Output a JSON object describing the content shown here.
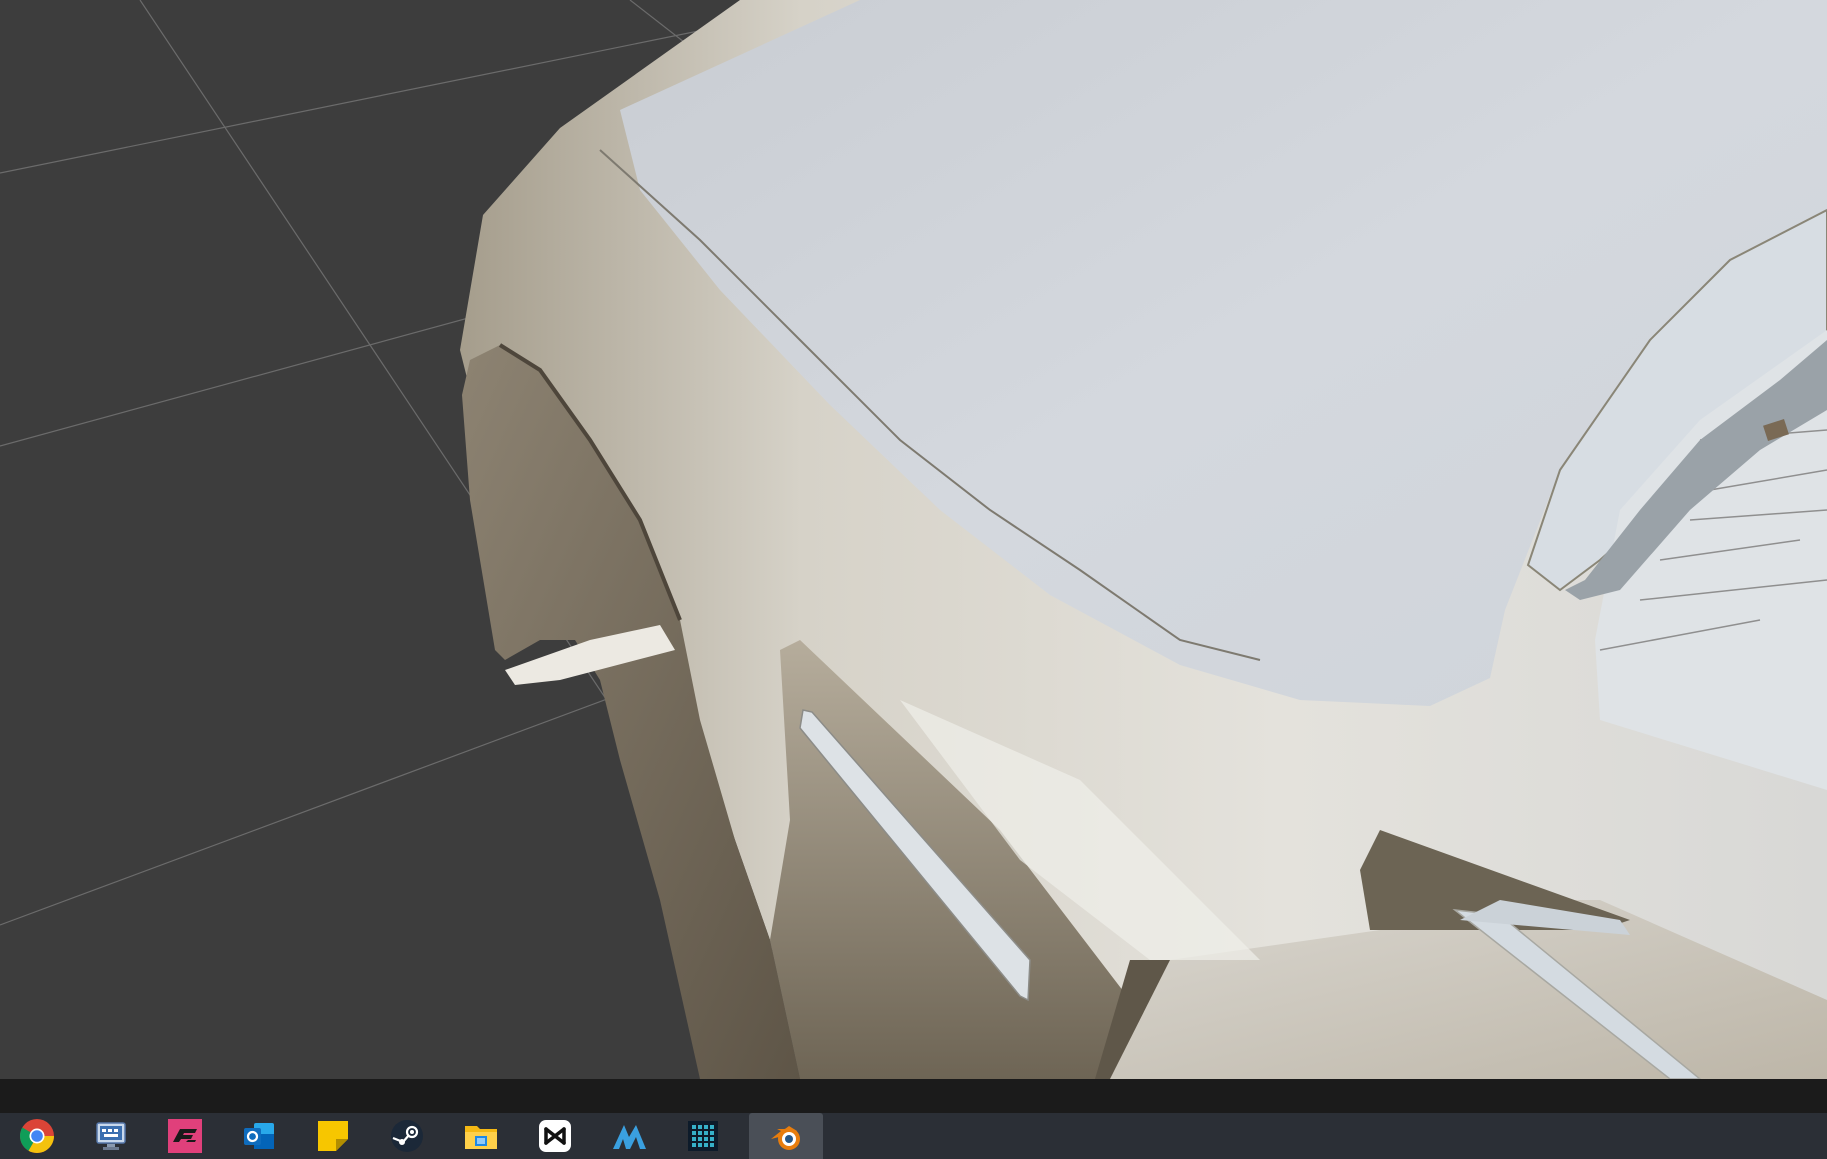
{
  "scene": {
    "background_color": "#3d3d3d",
    "grid_line_color": "#6a6a6a",
    "model_subject": "car-front-fender-hood"
  },
  "taskbar": {
    "background_color": "#2b2f36",
    "active_color": "#4a4f57",
    "apps": [
      {
        "id": "chrome",
        "icon": "chrome-icon",
        "active": false
      },
      {
        "id": "remote-desktop",
        "icon": "remote-desktop-icon",
        "active": false
      },
      {
        "id": "forza",
        "icon": "forza-icon",
        "active": false
      },
      {
        "id": "outlook",
        "icon": "outlook-icon",
        "active": false
      },
      {
        "id": "sticky-notes",
        "icon": "sticky-notes-icon",
        "active": false
      },
      {
        "id": "steam",
        "icon": "steam-icon",
        "active": false
      },
      {
        "id": "file-explorer",
        "icon": "file-explorer-icon",
        "active": false
      },
      {
        "id": "capcut",
        "icon": "capcut-icon",
        "active": false
      },
      {
        "id": "m-app",
        "icon": "m-app-icon",
        "active": false
      },
      {
        "id": "calculator-grid",
        "icon": "grid-app-icon",
        "active": false
      },
      {
        "id": "blender",
        "icon": "blender-icon",
        "active": true
      }
    ]
  }
}
